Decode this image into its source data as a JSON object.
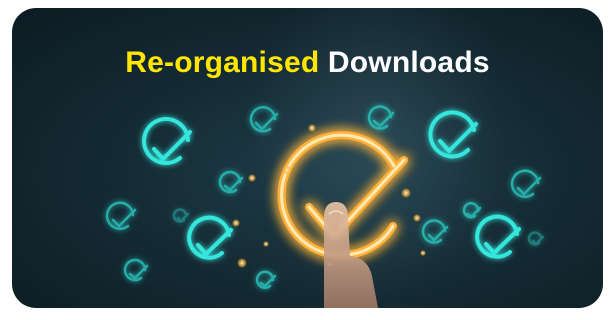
{
  "banner": {
    "headline_accent": "Re-organised",
    "headline_rest": "Downloads"
  },
  "colors": {
    "accent_yellow": "#ffe600",
    "glow_orange": "#ffb23a",
    "check_cyan": "#35e6dc",
    "background": "#152c35"
  },
  "icons": [
    "check-circle-icon",
    "large-check-circle-icon",
    "hand-icon"
  ]
}
